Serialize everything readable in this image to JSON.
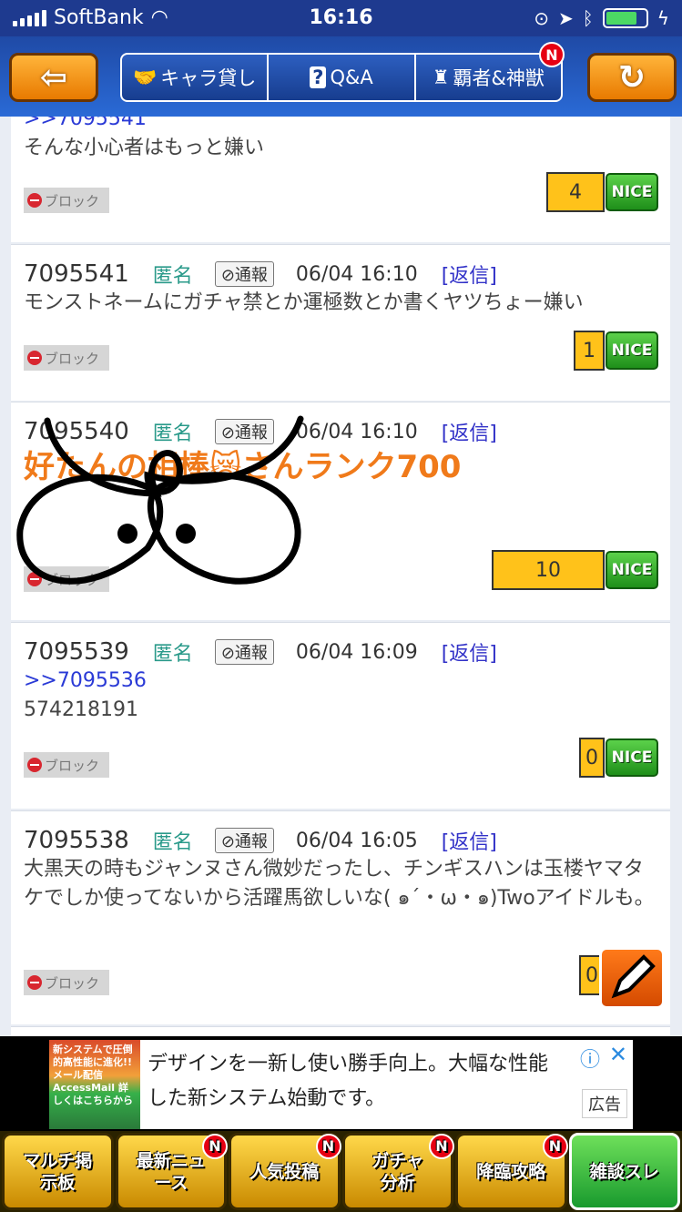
{
  "status_bar": {
    "carrier": "SoftBank",
    "time": "16:16"
  },
  "header": {
    "back_icon": "arrow-left-icon",
    "tabs": [
      {
        "label": "キャラ貸し",
        "icon": "handshake-icon"
      },
      {
        "label": "Q&A",
        "icon": "question-icon"
      },
      {
        "label": "覇者&神獣",
        "icon": "tower-icon"
      }
    ],
    "tab_badge": "N",
    "refresh_icon": "refresh-icon"
  },
  "posts": [
    {
      "ref": ">>7095541",
      "body": "そんな小心者はもっと嫌い",
      "block_label": "ブロック",
      "nice_count": "4",
      "nice_label": "NICE"
    },
    {
      "num": "7095541",
      "author": "匿名",
      "report_label": "通報",
      "date": "06/04 16:10",
      "reply_label": "[返信]",
      "body": "モンストネームにガチャ禁とか運極数とか書くヤツちょー嫌い",
      "block_label": "ブロック",
      "nice_count": "1",
      "nice_label": "NICE"
    },
    {
      "num": "7095540",
      "author": "匿名",
      "report_label": "通報",
      "date": "06/04 16:10",
      "reply_label": "[返信]",
      "body": "好たんの相棒😿さんランク700",
      "block_label": "ブロック",
      "nice_count": "10",
      "nice_label": "NICE"
    },
    {
      "num": "7095539",
      "author": "匿名",
      "report_label": "通報",
      "date": "06/04 16:09",
      "reply_label": "[返信]",
      "ref": ">>7095536",
      "body": "574218191",
      "block_label": "ブロック",
      "nice_count": "0",
      "nice_label": "NICE"
    },
    {
      "num": "7095538",
      "author": "匿名",
      "report_label": "通報",
      "date": "06/04 16:05",
      "reply_label": "[返信]",
      "body": "大黒天の時もジャンヌさん微妙だったし、チンギスハンは玉楼ヤマタケでしか使ってないから活躍馬欲しいな( ๑´・ω・๑)Twoアイドルも。",
      "block_label": "ブロック",
      "nice_count": "0"
    }
  ],
  "ad": {
    "image_text": "新システムで圧倒的高性能に進化!! メール配信 AccessMail 詳しくはこちらから",
    "line1": "デザインを一新し使い勝手向上。大幅な性能",
    "line2": "した新システム始動です。",
    "label": "広告"
  },
  "bottom_nav": [
    {
      "label": "マルチ掲示板"
    },
    {
      "label": "最新ニュース",
      "badge": "N"
    },
    {
      "label": "人気投稿",
      "badge": "N"
    },
    {
      "label": "ガチャ分析",
      "badge": "N"
    },
    {
      "label": "降臨攻略",
      "badge": "N"
    },
    {
      "label": "雑談スレ"
    }
  ]
}
